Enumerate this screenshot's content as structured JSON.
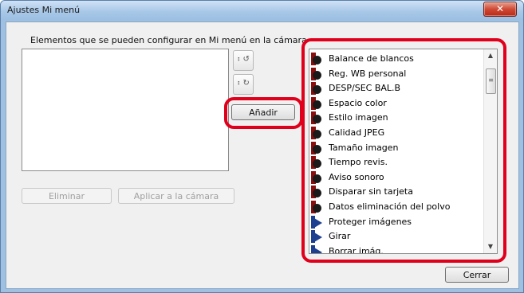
{
  "window": {
    "title": "Ajustes Mi menú",
    "close_glyph": "✕"
  },
  "group_label": "Elementos que se pueden configurar en Mi menú en la cámara",
  "buttons": {
    "move_up_icon": "move-up-icon",
    "move_down_icon": "move-down-icon",
    "add": "Añadir",
    "remove": "Eliminar",
    "apply": "Aplicar a la cámara",
    "close": "Cerrar"
  },
  "available_items": [
    {
      "label": "Balance de blancos",
      "icon": "shooting-menu-icon"
    },
    {
      "label": "Reg. WB personal",
      "icon": "shooting-menu-icon"
    },
    {
      "label": "DESP/SEC BAL.B",
      "icon": "shooting-menu-icon"
    },
    {
      "label": "Espacio color",
      "icon": "shooting-menu-icon"
    },
    {
      "label": "Estilo imagen",
      "icon": "shooting-menu-icon"
    },
    {
      "label": "Calidad JPEG",
      "icon": "shooting-menu-icon"
    },
    {
      "label": "Tamaño imagen",
      "icon": "shooting-menu-icon"
    },
    {
      "label": "Tiempo revis.",
      "icon": "shooting-menu-icon"
    },
    {
      "label": "Aviso sonoro",
      "icon": "shooting-menu-icon"
    },
    {
      "label": "Disparar sin tarjeta",
      "icon": "shooting-menu-icon"
    },
    {
      "label": "Datos eliminación del polvo",
      "icon": "shooting-menu-icon"
    },
    {
      "label": "Proteger imágenes",
      "icon": "playback-menu-icon"
    },
    {
      "label": "Girar",
      "icon": "playback-menu-icon"
    },
    {
      "label": "Borrar imág.",
      "icon": "playback-menu-icon"
    }
  ],
  "selected_items": [],
  "colors": {
    "highlight": "#e0001b",
    "shooting_icon": "#8b0d0d",
    "playback_icon": "#1d3f8f"
  }
}
